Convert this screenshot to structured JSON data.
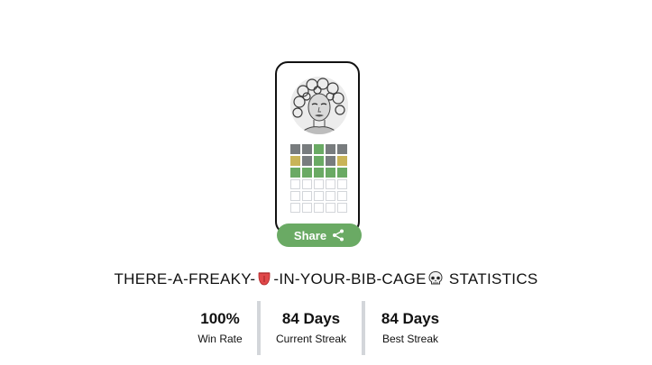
{
  "game": {
    "title_before": "THERE-A-FREAKY-",
    "title_middle": "-IN-YOUR-BIB-CAGE",
    "title_after": " STATISTICS",
    "emoji_1": "tongue-emoji",
    "emoji_2": "skull-emoji"
  },
  "grid": {
    "rows": [
      [
        "absent",
        "absent",
        "correct",
        "absent",
        "absent"
      ],
      [
        "present",
        "absent",
        "correct",
        "absent",
        "present"
      ],
      [
        "correct",
        "correct",
        "correct",
        "correct",
        "correct"
      ],
      [
        "empty",
        "empty",
        "empty",
        "empty",
        "empty"
      ],
      [
        "empty",
        "empty",
        "empty",
        "empty",
        "empty"
      ],
      [
        "empty",
        "empty",
        "empty",
        "empty",
        "empty"
      ]
    ]
  },
  "share": {
    "label": "Share",
    "icon": "share-icon"
  },
  "stats": [
    {
      "value": "100%",
      "label": "Win Rate"
    },
    {
      "value": "84 Days",
      "label": "Current Streak"
    },
    {
      "value": "84 Days",
      "label": "Best Streak"
    }
  ],
  "colors": {
    "absent": "#787c7e",
    "present": "#c9b458",
    "correct": "#6aaa64",
    "empty_border": "#d3d6da",
    "share_button": "#6aaa64",
    "divider": "#d3d6da"
  }
}
